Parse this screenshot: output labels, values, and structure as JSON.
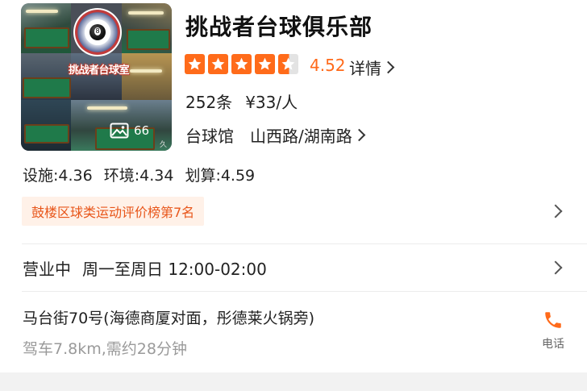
{
  "shop": {
    "name": "挑战者台球俱乐部",
    "rating": "4.52",
    "detail_label": "详情",
    "review_count": "252条",
    "avg_price": "¥33/人",
    "category": "台球馆",
    "area": "山西路/湖南路",
    "stars": 4.5
  },
  "photo": {
    "logo_caption": "挑战者台球室",
    "count": "66",
    "watermark": "久大"
  },
  "scores": {
    "facility": "设施:4.36",
    "environment": "环境:4.34",
    "value": "划算:4.59"
  },
  "ranking": {
    "text": "鼓楼区球类运动评价榜第7名"
  },
  "hours": {
    "status": "营业中",
    "schedule": "周一至周日 12:00-02:00"
  },
  "address": {
    "text": "马台街70号(海德商厦对面，彤德莱火锅旁)",
    "drive": "驾车7.8km,需约28分钟"
  },
  "phone": {
    "label": "电话"
  },
  "colors": {
    "accent": "#ff6a1a",
    "rank_bg": "#fff1e8",
    "rank_text": "#e8561a"
  }
}
